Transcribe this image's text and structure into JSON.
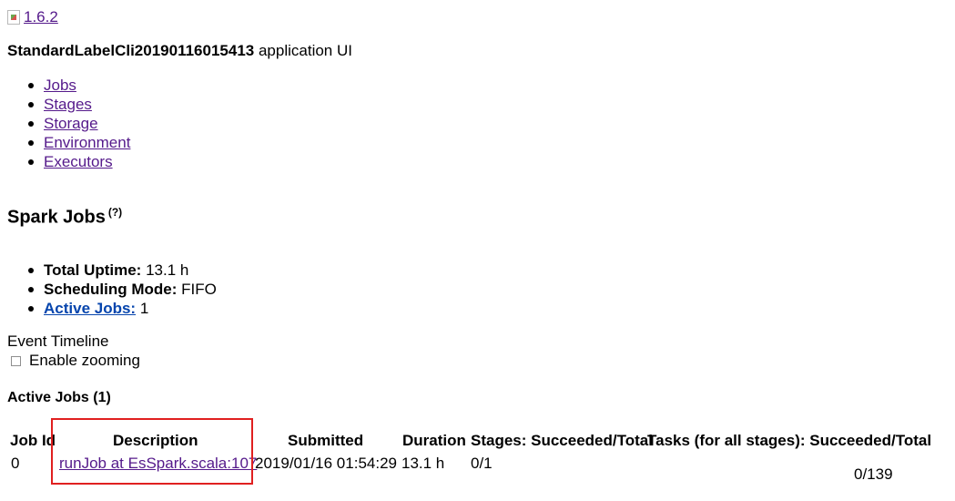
{
  "header": {
    "version": "1.6.2",
    "app_name": "StandardLabelCli20190116015413",
    "app_suffix": "application UI"
  },
  "nav": {
    "items": [
      "Jobs",
      "Stages",
      "Storage",
      "Environment",
      "Executors"
    ]
  },
  "page": {
    "title": "Spark Jobs",
    "help": "(?)"
  },
  "summary": {
    "uptime_label": "Total Uptime:",
    "uptime_value": "13.1 h",
    "mode_label": "Scheduling Mode:",
    "mode_value": "FIFO",
    "active_label": "Active Jobs:",
    "active_value": "1"
  },
  "timeline": {
    "label": "Event Timeline",
    "zoom_label": "Enable zooming",
    "zoom_checked": false
  },
  "active_jobs": {
    "heading": "Active Jobs (1)",
    "columns": [
      "Job Id",
      "Description",
      "Submitted",
      "Duration",
      "Stages: Succeeded/Total",
      "Tasks (for all stages): Succeeded/Total"
    ],
    "rows": [
      {
        "job_id": "0",
        "description": "runJob at EsSpark.scala:107",
        "submitted": "2019/01/16 01:54:29",
        "duration": "13.1 h",
        "stages": "0/1",
        "tasks": "0/139"
      }
    ]
  },
  "colors": {
    "link": "#551a8b",
    "active_link": "#0645ad",
    "highlight": "#e02020"
  }
}
